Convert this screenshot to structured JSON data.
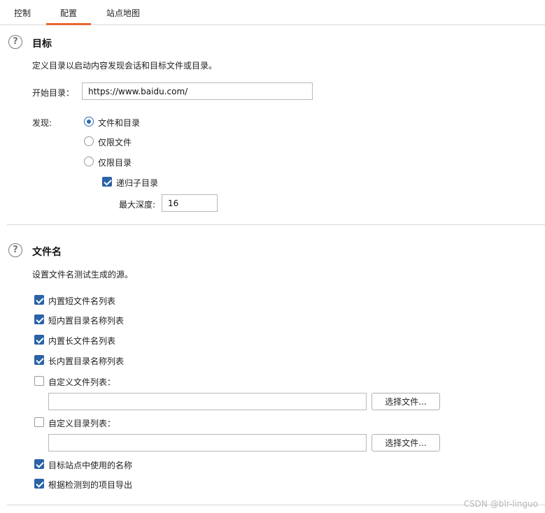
{
  "tabs": [
    {
      "label": "控制",
      "active": false
    },
    {
      "label": "配置",
      "active": true
    },
    {
      "label": "站点地图",
      "active": false
    }
  ],
  "target": {
    "title": "目标",
    "description": "定义目录以启动内容发现会话和目标文件或目录。",
    "start_dir_label": "开始目录：",
    "start_dir_value": "https://www.baidu.com/",
    "discover_label": "发现:",
    "options": [
      {
        "label": "文件和目录",
        "checked": true
      },
      {
        "label": "仅限文件",
        "checked": false
      },
      {
        "label": "仅限目录",
        "checked": false
      }
    ],
    "recursive_label": "递归子目录",
    "recursive_checked": true,
    "max_depth_label": "最大深度:",
    "max_depth_value": "16"
  },
  "filenames": {
    "title": "文件名",
    "description": "设置文件名测试生成的源。",
    "builtin": [
      {
        "label": "内置短文件名列表",
        "checked": true
      },
      {
        "label": "短内置目录名称列表",
        "checked": true
      },
      {
        "label": "内置长文件名列表",
        "checked": true
      },
      {
        "label": "长内置目录名称列表",
        "checked": true
      }
    ],
    "custom_file_label": "自定义文件列表：",
    "custom_file_checked": false,
    "custom_file_value": "",
    "custom_dir_label": "自定义目录列表：",
    "custom_dir_checked": false,
    "custom_dir_value": "",
    "choose_file_button": "选择文件...",
    "site_names_label": "目标站点中使用的名称",
    "site_names_checked": true,
    "derived_label": "根据检测到的项目导出",
    "derived_checked": true
  },
  "watermark": "CSDN @blr-linguo",
  "colors": {
    "accent_tab": "#e8662f",
    "checkbox": "#2b62a8",
    "radio": "#2f6bb3"
  }
}
